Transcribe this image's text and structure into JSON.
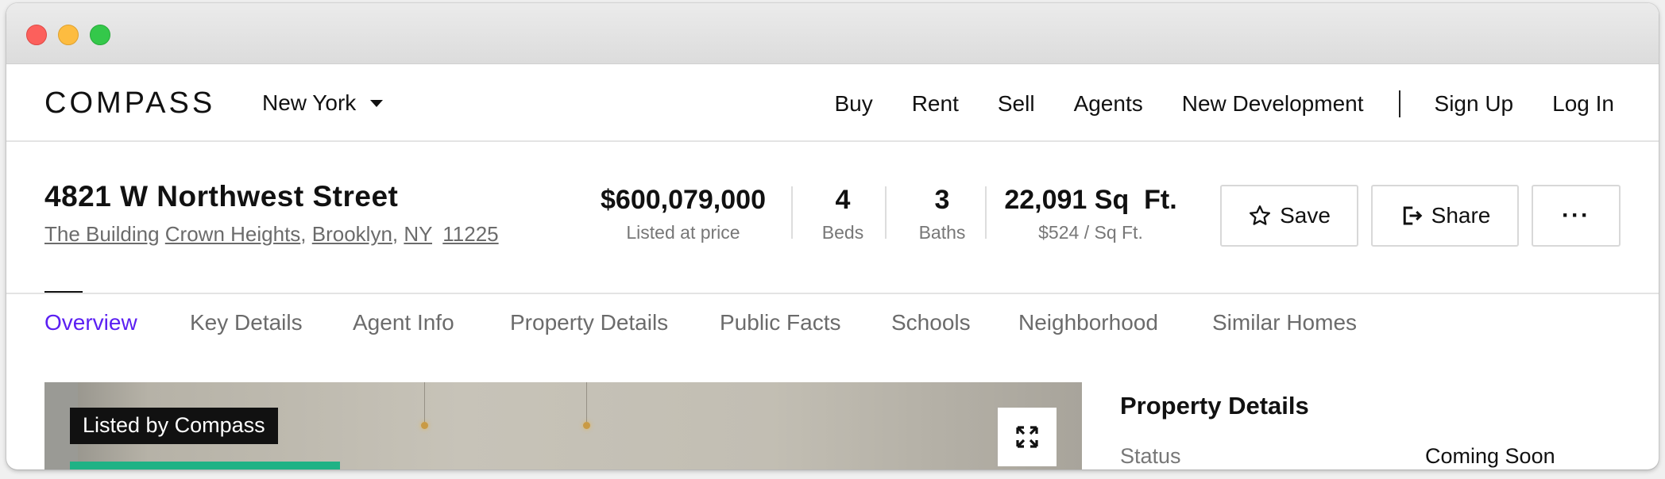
{
  "brand": {
    "logo": "COMPASS",
    "city": "New York"
  },
  "nav": {
    "links": [
      "Buy",
      "Rent",
      "Sell",
      "Agents",
      "New Development"
    ],
    "sign_up": "Sign Up",
    "log_in": "Log In"
  },
  "listing": {
    "title": "4821 W Northwest Street",
    "building": "The Building",
    "neighborhood": "Crown Heights",
    "borough": "Brooklyn",
    "state": "NY",
    "zip": "11225",
    "price": "$600,079,000",
    "price_label": "Listed at price",
    "beds": "4",
    "beds_label": "Beds",
    "baths": "3",
    "baths_label": "Baths",
    "sqft": "22,091 Sq  Ft.",
    "price_per_sqft": "$524 / Sq Ft."
  },
  "actions": {
    "save": "Save",
    "share": "Share",
    "more": "···"
  },
  "tabs": [
    "Overview",
    "Key Details",
    "Agent Info",
    "Property Details",
    "Public Facts",
    "Schools",
    "Neighborhood",
    "Similar Homes"
  ],
  "active_tab": "Overview",
  "hero": {
    "badge": "Listed by Compass"
  },
  "property_details": {
    "title": "Property Details",
    "status_label": "Status",
    "status_value": "Coming Soon"
  },
  "colors": {
    "accent": "#5b1ff2",
    "brand_green": "#1fb285",
    "badge_bg": "#111111"
  }
}
